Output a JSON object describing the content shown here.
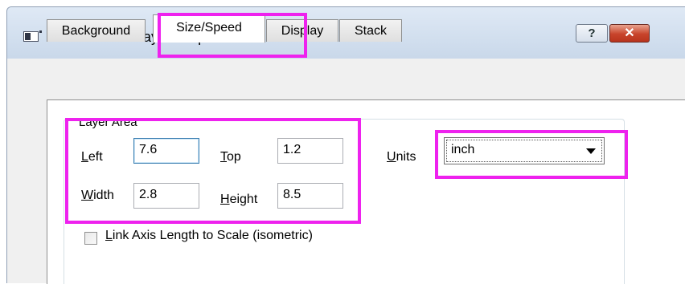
{
  "window": {
    "title": "Plot Details - Layer Properties",
    "help_glyph": "?",
    "close_glyph": "✕"
  },
  "tabs": [
    {
      "label": "Background",
      "active": false
    },
    {
      "label": "Size/Speed",
      "active": true
    },
    {
      "label": "Display",
      "active": false
    },
    {
      "label": "Stack",
      "active": false
    }
  ],
  "layer_area": {
    "group_label": "Layer Area",
    "left": {
      "label_accel": "L",
      "label_rest": "eft",
      "value": "7.6"
    },
    "top": {
      "label_accel": "T",
      "label_rest": "op",
      "value": "1.2"
    },
    "width": {
      "label_accel": "W",
      "label_rest": "idth",
      "value": "2.8"
    },
    "height": {
      "label_accel": "H",
      "label_rest": "eight",
      "value": "8.5"
    }
  },
  "units": {
    "label_accel": "U",
    "label_rest": "nits",
    "selected": "inch"
  },
  "link_axis": {
    "label_accel": "L",
    "label_rest": "ink Axis Length to Scale (isometric)",
    "checked": false
  },
  "colors": {
    "highlight": "#ee22ee",
    "title_bar": "#cfdcec",
    "close_button": "#c8442b"
  }
}
